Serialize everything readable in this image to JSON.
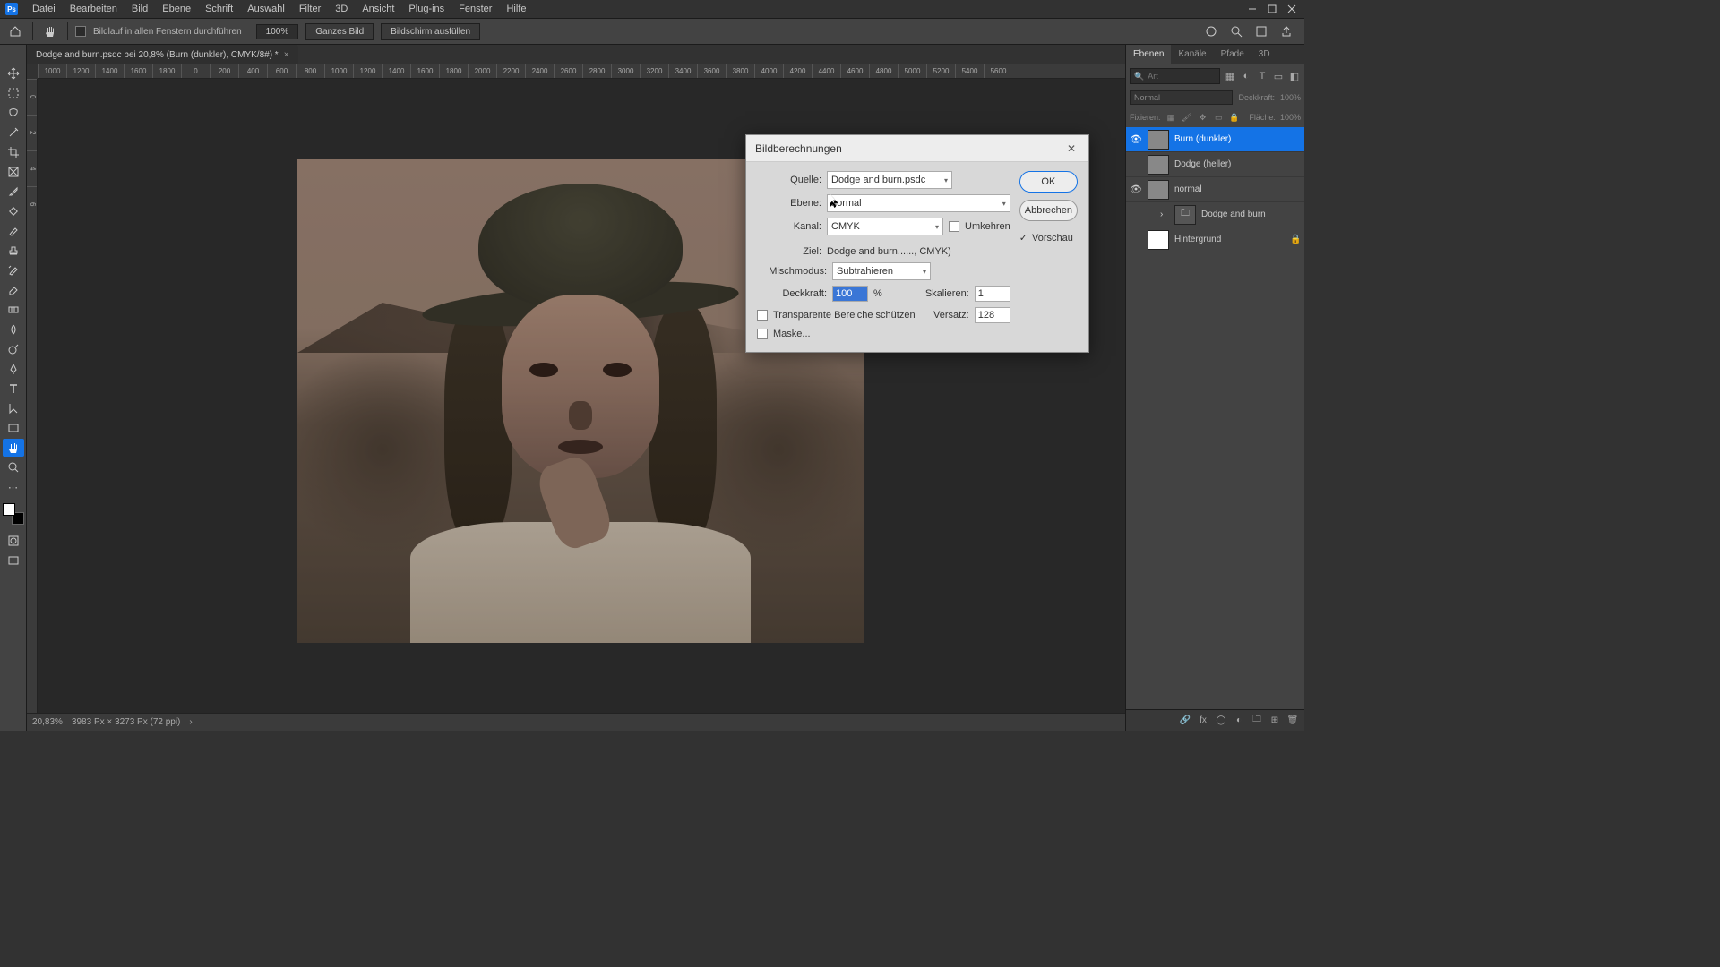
{
  "menubar": {
    "items": [
      "Datei",
      "Bearbeiten",
      "Bild",
      "Ebene",
      "Schrift",
      "Auswahl",
      "Filter",
      "3D",
      "Ansicht",
      "Plug-ins",
      "Fenster",
      "Hilfe"
    ]
  },
  "optbar": {
    "scroll_all_label": "Bildlauf in allen Fenstern durchführen",
    "zoom": "100%",
    "fit_label": "Ganzes Bild",
    "fill_label": "Bildschirm ausfüllen"
  },
  "doc_tab": {
    "title": "Dodge and burn.psdc bei 20,8% (Burn (dunkler), CMYK/8#) *"
  },
  "ruler_h": [
    "1000",
    "1200",
    "1400",
    "1600",
    "1800",
    "0",
    "200",
    "400",
    "600",
    "800",
    "1000",
    "1200",
    "1400",
    "1600",
    "1800",
    "2000",
    "2200",
    "2400",
    "2600",
    "2800",
    "3000",
    "3200",
    "3400",
    "3600",
    "3800",
    "4000",
    "4200",
    "4400",
    "4600",
    "4800",
    "5000",
    "5200",
    "5400",
    "5600"
  ],
  "ruler_v": [
    "0",
    "2",
    "4",
    "6"
  ],
  "statusbar": {
    "zoom": "20,83%",
    "info": "3983 Px × 3273 Px (72 ppi)"
  },
  "dialog": {
    "title": "Bildberechnungen",
    "source_label": "Quelle:",
    "source_value": "Dodge and burn.psdc",
    "layer_label": "Ebene:",
    "layer_value": "normal",
    "channel_label": "Kanal:",
    "channel_value": "CMYK",
    "invert_label": "Umkehren",
    "target_label": "Ziel:",
    "target_value": "Dodge and burn......, CMYK)",
    "blend_label": "Mischmodus:",
    "blend_value": "Subtrahieren",
    "opacity_label": "Deckkraft:",
    "opacity_value": "100",
    "opacity_unit": "%",
    "scale_label": "Skalieren:",
    "scale_value": "1",
    "offset_label": "Versatz:",
    "offset_value": "128",
    "transp_label": "Transparente Bereiche schützen",
    "mask_label": "Maske...",
    "ok": "OK",
    "cancel": "Abbrechen",
    "preview": "Vorschau"
  },
  "panels": {
    "tabs": [
      "Ebenen",
      "Kanäle",
      "Pfade",
      "3D"
    ],
    "search_placeholder": "Art",
    "blend_label": "Normal",
    "opacity_label": "Deckkraft:",
    "opacity_value": "100%",
    "lock_label": "Fixieren:",
    "fill_label": "Fläche:",
    "fill_value": "100%",
    "layers": [
      {
        "visible": true,
        "name": "Burn (dunkler)",
        "active": true,
        "thumb": "img"
      },
      {
        "visible": false,
        "name": "Dodge (heller)",
        "thumb": "img"
      },
      {
        "visible": true,
        "name": "normal",
        "thumb": "img"
      },
      {
        "visible": false,
        "name": "Dodge and burn",
        "thumb": "folder",
        "indent": true
      },
      {
        "visible": false,
        "name": "Hintergrund",
        "thumb": "white",
        "locked": true
      }
    ]
  }
}
